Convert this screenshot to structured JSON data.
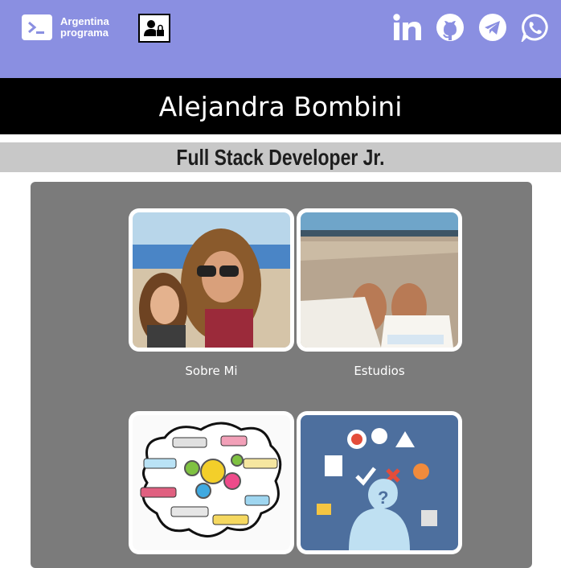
{
  "header": {
    "logo_text_line1": "Argentina",
    "logo_text_line2": "programa",
    "login_icon": "user-lock-icon",
    "social": [
      {
        "name": "linkedin-icon"
      },
      {
        "name": "github-icon"
      },
      {
        "name": "telegram-icon"
      },
      {
        "name": "whatsapp-icon"
      }
    ]
  },
  "profile": {
    "name": "Alejandra Bombini",
    "title": "Full Stack Developer Jr."
  },
  "cards": [
    {
      "label": "Sobre Mi",
      "image": "selfie-photo"
    },
    {
      "label": "Estudios",
      "image": "beach-book-photo"
    },
    {
      "label": "",
      "image": "skills-cloud-illustration"
    },
    {
      "label": "",
      "image": "projects-illustration"
    }
  ],
  "colors": {
    "header_bg": "#8a8fe1",
    "name_bar_bg": "#000000",
    "title_bar_bg": "#c8c8c8",
    "panel_bg": "#7b7b7b"
  }
}
